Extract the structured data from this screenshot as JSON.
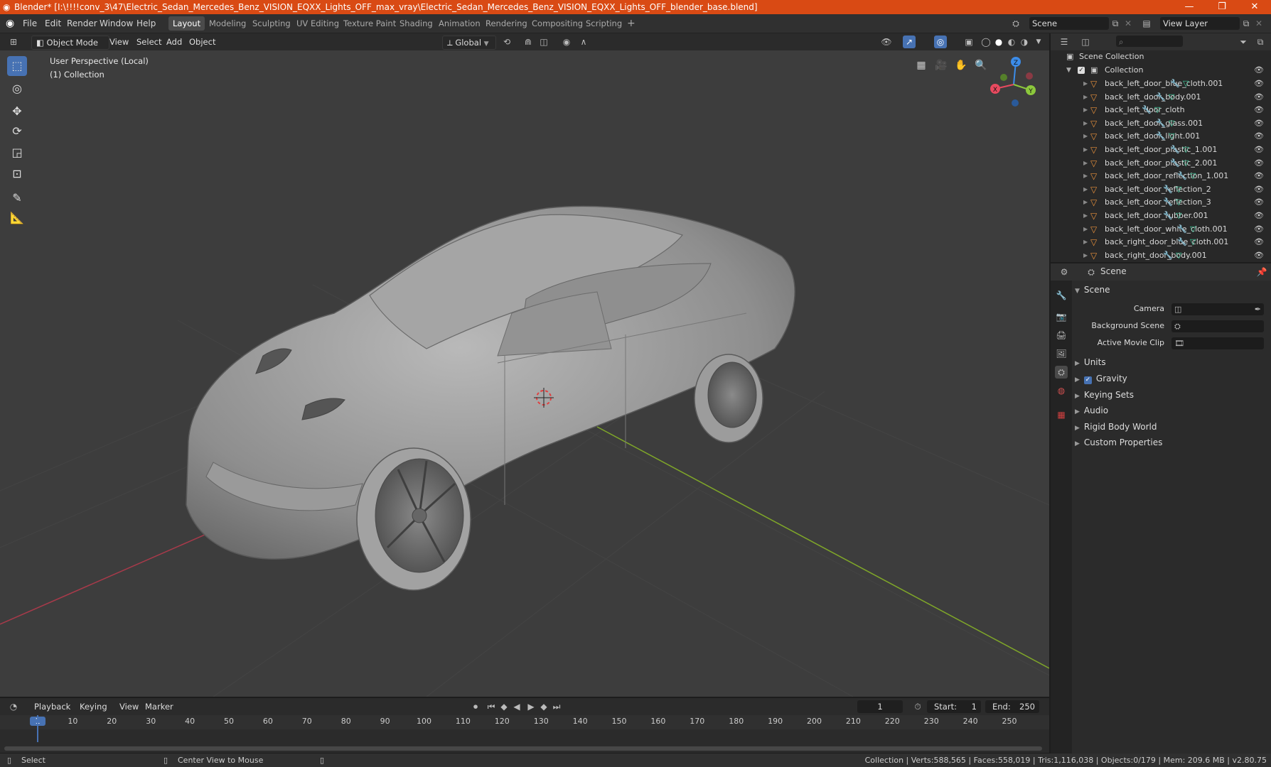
{
  "window": {
    "title": "Blender* [I:\\!!!!conv_3\\47\\Electric_Sedan_Mercedes_Benz_VISION_EQXX_Lights_OFF_max_vray\\Electric_Sedan_Mercedes_Benz_VISION_EQXX_Lights_OFF_blender_base.blend]",
    "minimize": "—",
    "maximize": "❐",
    "close": "✕"
  },
  "menu": [
    "File",
    "Edit",
    "Render",
    "Window",
    "Help"
  ],
  "workspaces": [
    "Layout",
    "Modeling",
    "Sculpting",
    "UV Editing",
    "Texture Paint",
    "Shading",
    "Animation",
    "Rendering",
    "Compositing",
    "Scripting"
  ],
  "workspace_add": "+",
  "scene_field": "Scene",
  "view_layer_field": "View Layer",
  "viewport_header": {
    "mode": "Object Mode",
    "menus": [
      "View",
      "Select",
      "Add",
      "Object"
    ],
    "transform_orientation": "Global"
  },
  "viewport": {
    "perspective_label": "User Perspective (Local)",
    "collection_label": "(1) Collection",
    "gizmo": {
      "z": "Z",
      "x": "X",
      "y": "Y"
    }
  },
  "outliner": {
    "root": "Scene Collection",
    "collection": "Collection",
    "items": [
      "back_left_door_blue_cloth.001",
      "back_left_door_body.001",
      "back_left_door_cloth",
      "back_left_door_glass.001",
      "back_left_door_light.001",
      "back_left_door_plastic_1.001",
      "back_left_door_plastic_2.001",
      "back_left_door_reflection_1.001",
      "back_left_door_reflection_2",
      "back_left_door_reflection_3",
      "back_left_door_rubber.001",
      "back_left_door_white_cloth.001",
      "back_right_door_blue_cloth.001",
      "back_right_door_body.001"
    ]
  },
  "properties": {
    "context": "Scene",
    "panel_title": "Scene",
    "camera_label": "Camera",
    "background_scene_label": "Background Scene",
    "active_movie_clip_label": "Active Movie Clip",
    "sections": [
      "Units",
      "Gravity",
      "Keying Sets",
      "Audio",
      "Rigid Body World",
      "Custom Properties"
    ],
    "gravity_checked": true
  },
  "timeline": {
    "menus": [
      "Playback",
      "Keying",
      "View",
      "Marker"
    ],
    "current_frame": "1",
    "start_label": "Start:",
    "start": "1",
    "end_label": "End:",
    "end": "250",
    "ticks": [
      "1",
      "10",
      "20",
      "30",
      "40",
      "50",
      "60",
      "70",
      "80",
      "90",
      "100",
      "110",
      "120",
      "130",
      "140",
      "150",
      "160",
      "170",
      "180",
      "190",
      "200",
      "210",
      "220",
      "230",
      "240",
      "250"
    ]
  },
  "statusbar": {
    "select": "Select",
    "center_view": "Center View to Mouse",
    "stats": "Collection | Verts:588,565 | Faces:558,019 | Tris:1,116,038 | Objects:0/179 | Mem: 209.6 MB | v2.80.75"
  },
  "colors": {
    "titlebar": "#d94a14",
    "accent": "#4772b3",
    "object_icon": "#e8913c",
    "x_axis": "#e84a5f",
    "y_axis": "#8cc83c",
    "z_axis": "#3c8ce8"
  }
}
